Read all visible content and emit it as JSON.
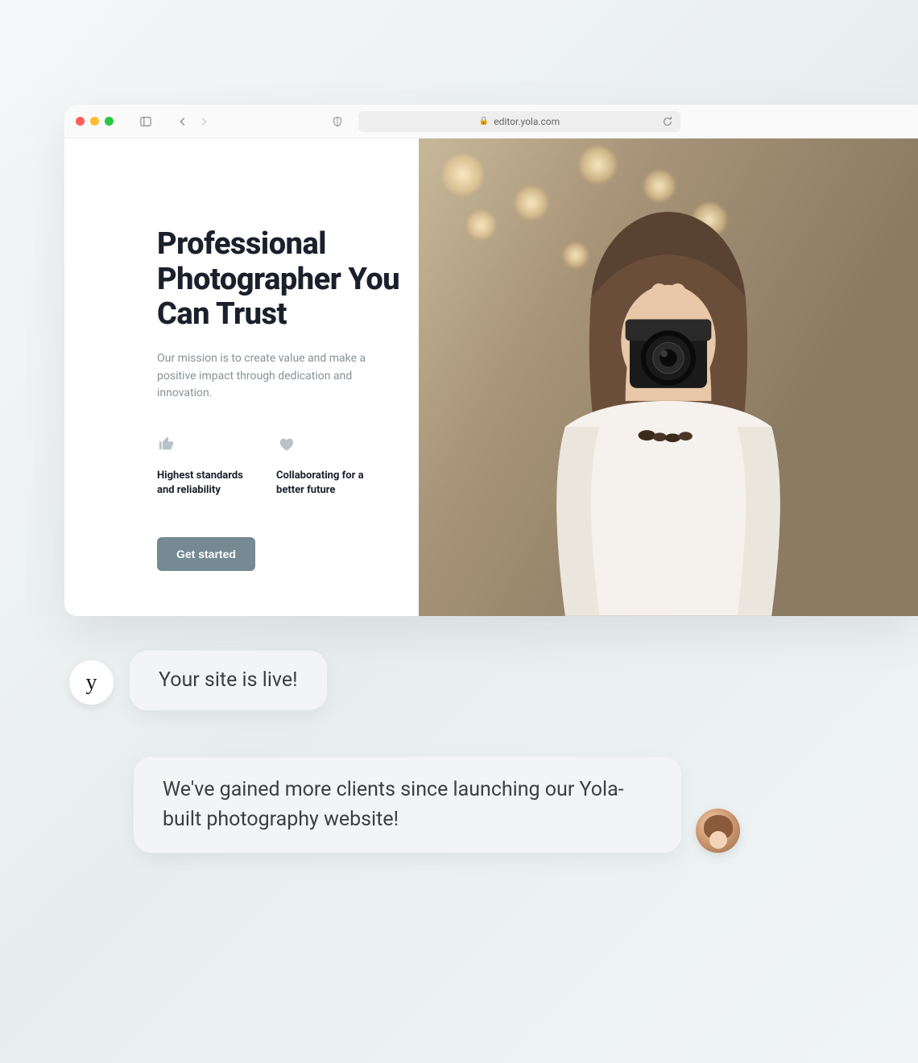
{
  "browser": {
    "url": "editor.yola.com"
  },
  "hero": {
    "heading": "Professional Photographer You Can Trust",
    "mission": "Our mission is to create value and make a positive impact through dedication and innovation.",
    "features": [
      {
        "icon": "thumbs-up-icon",
        "label": "Highest standards and reliability"
      },
      {
        "icon": "heart-icon",
        "label": "Collaborating for a better future"
      }
    ],
    "cta_label": "Get started"
  },
  "chat": {
    "bot_avatar_letter": "y",
    "bot_message": "Your site is live!",
    "user_message": "We've gained more clients since launching our Yola-built photography website!"
  }
}
